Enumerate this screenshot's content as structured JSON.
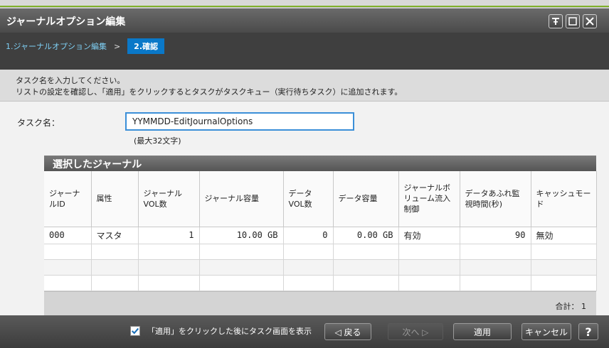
{
  "window": {
    "title": "ジャーナルオプション編集"
  },
  "wizard": {
    "step1": "1.ジャーナルオプション編集",
    "separator": ">",
    "step2": "2.確認"
  },
  "instructions": {
    "line1": "タスク名を入力してください。",
    "line2": "リストの設定を確認し、「適用」をクリックするとタスクがタスクキュー（実行待ちタスク）に追加されます。"
  },
  "task": {
    "label": "タスク名：",
    "value": "YYMMDD-EditJournalOptions",
    "hint": "(最大32文字)"
  },
  "selected": {
    "title": "選択したジャーナル",
    "headers": [
      "ジャーナルID",
      "属性",
      "ジャーナルVOL数",
      "ジャーナル容量",
      "データVOL数",
      "データ容量",
      "ジャーナルボリューム流入制御",
      "データあふれ監視時間(秒)",
      "キャッシュモード"
    ],
    "rows": [
      [
        "000",
        "マスタ",
        "1",
        "10.00 GB",
        "0",
        "0.00 GB",
        "有効",
        "90",
        "無効"
      ]
    ],
    "total_label": "合計：",
    "total_value": "1"
  },
  "footer": {
    "checkbox_label": "「適用」をクリックした後にタスク画面を表示",
    "checked": true,
    "back": "◁ 戻る",
    "next": "次へ ▷",
    "apply": "適用",
    "cancel": "キャンセル",
    "help": "?"
  }
}
